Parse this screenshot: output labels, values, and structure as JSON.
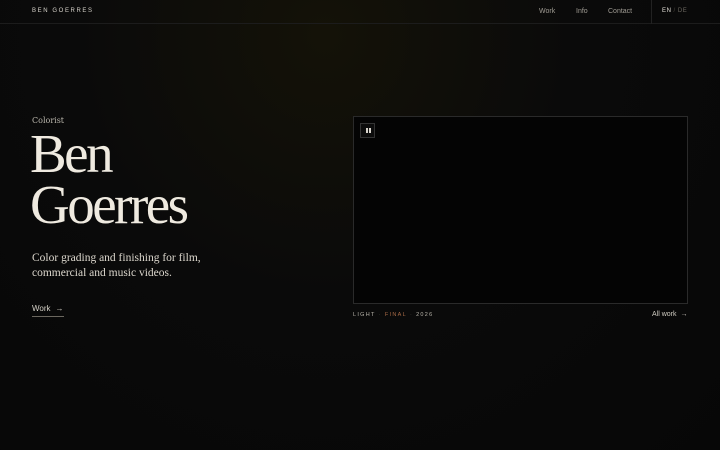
{
  "brand": "BEN GOERRES",
  "nav": {
    "work": "Work",
    "info": "Info",
    "contact": "Contact"
  },
  "lang": {
    "en": "EN",
    "separator": "/",
    "de": "DE",
    "active": "EN"
  },
  "hero": {
    "eyebrow": "Colorist",
    "name_line1": "Ben",
    "name_line2": "Goerres",
    "tagline": "Color grading and finishing for film, commercial and music videos.",
    "cta": "Work",
    "cta_arrow": "→"
  },
  "player": {
    "state": "playing",
    "control_icon": "pause-icon"
  },
  "caption": {
    "part1": "LIGHT",
    "part2": "FINAL",
    "part3": "2026",
    "dot": "·"
  },
  "all_work": {
    "label": "All work",
    "arrow": "→"
  },
  "colors": {
    "background": "#0a0a0a",
    "text": "#efeae0",
    "accent": "#a86a46"
  }
}
